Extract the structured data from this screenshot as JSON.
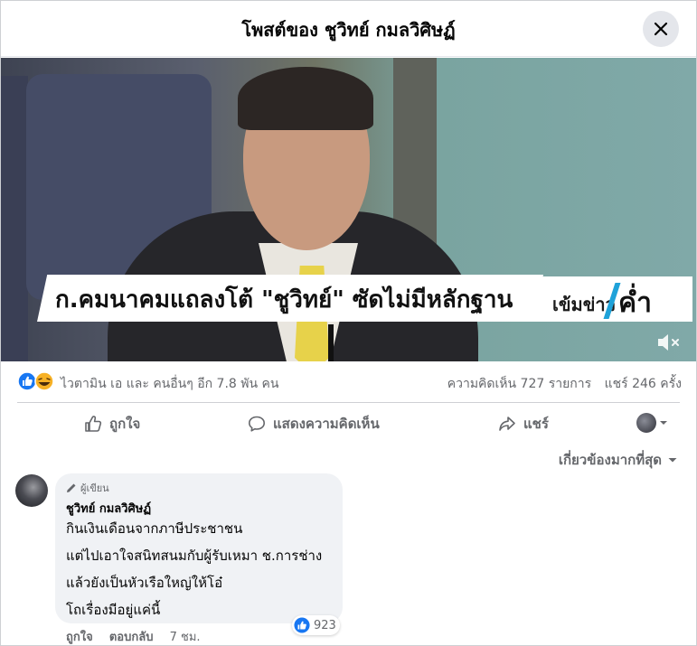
{
  "header": {
    "title": "โพสต์ของ ชูวิทย์ กมลวิศิษฏ์"
  },
  "video": {
    "headline": "ก.คมนาคมแถลงโต้ \"ชูวิทย์\" ซัดไม่มีหลักฐาน",
    "brand_part1": "เข้มข่าว",
    "brand_part2": "ค่ำ"
  },
  "stats": {
    "reactions_text": "ไวตามิน เอ และ คนอื่นๆ อีก 7.8 พัน คน",
    "comments": "ความคิดเห็น 727 รายการ",
    "shares": "แชร์ 246 ครั้ง"
  },
  "actions": {
    "like": "ถูกใจ",
    "comment": "แสดงความคิดเห็น",
    "share": "แชร์"
  },
  "sort": {
    "label": "เกี่ยวข้องมากที่สุด"
  },
  "comment": {
    "badge": "ผู้เขียน",
    "author": "ชูวิทย์ กมลวิศิษฏ์",
    "lines": [
      "กินเงินเดือนจากภาษีประชาชน",
      "แต่ไปเอาใจสนิทสนมกับผู้รับเหมา ช.การช่าง",
      "แล้วยังเป็นหัวเรือใหญ่ให้โอ๋",
      "โถเรื่องมีอยู่แค่นี้"
    ],
    "like_count": "923",
    "like_label": "ถูกใจ",
    "reply_label": "ตอบกลับ",
    "time": "7 ชม."
  },
  "colors": {
    "accent": "#1877f2",
    "muted": "#65676b",
    "bubble": "#f0f2f5"
  }
}
